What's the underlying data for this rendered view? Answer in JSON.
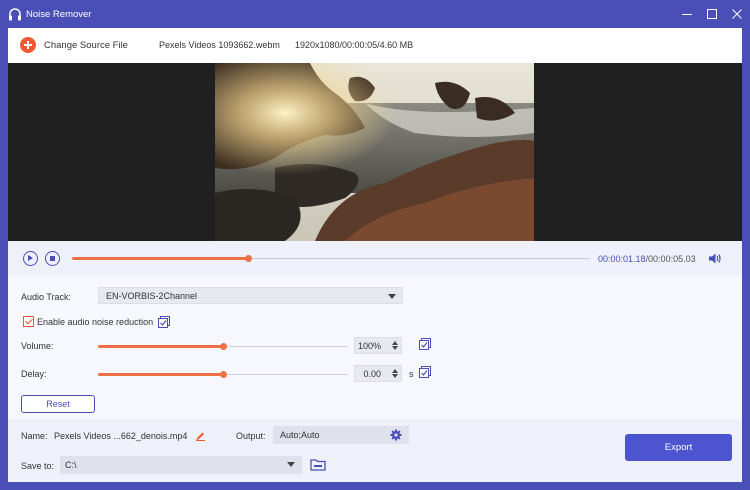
{
  "window": {
    "title": "Noise Remover"
  },
  "topbar": {
    "change_source_label": "Change Source File",
    "filename": "Pexels Videos 1093662.webm",
    "fileinfo": "1920x1080/00:00:05/4.60 MB"
  },
  "player": {
    "current_time": "00:00:01.18",
    "total_time": "/00:00:05.03",
    "progress_fraction": 0.34
  },
  "audio": {
    "track_label": "Audio Track:",
    "track_value": "EN-VORBIS-2Channel",
    "noise_reduction_label": "Enable audio noise reduction",
    "noise_reduction_checked": true,
    "volume_label": "Volume:",
    "volume_value": "100%",
    "volume_fraction": 0.5,
    "delay_label": "Delay:",
    "delay_value": "0.00",
    "delay_unit": "s",
    "delay_fraction": 0.5,
    "reset_label": "Reset"
  },
  "output": {
    "name_label": "Name:",
    "name_value": "Pexels Videos ...662_denois.mp4",
    "output_label": "Output:",
    "output_value": "Auto;Auto",
    "save_to_label": "Save to:",
    "save_to_value": "C:\\",
    "export_label": "Export"
  },
  "colors": {
    "accent": "#4a4fb8",
    "orange": "#f07046",
    "export": "#4c55cf"
  }
}
